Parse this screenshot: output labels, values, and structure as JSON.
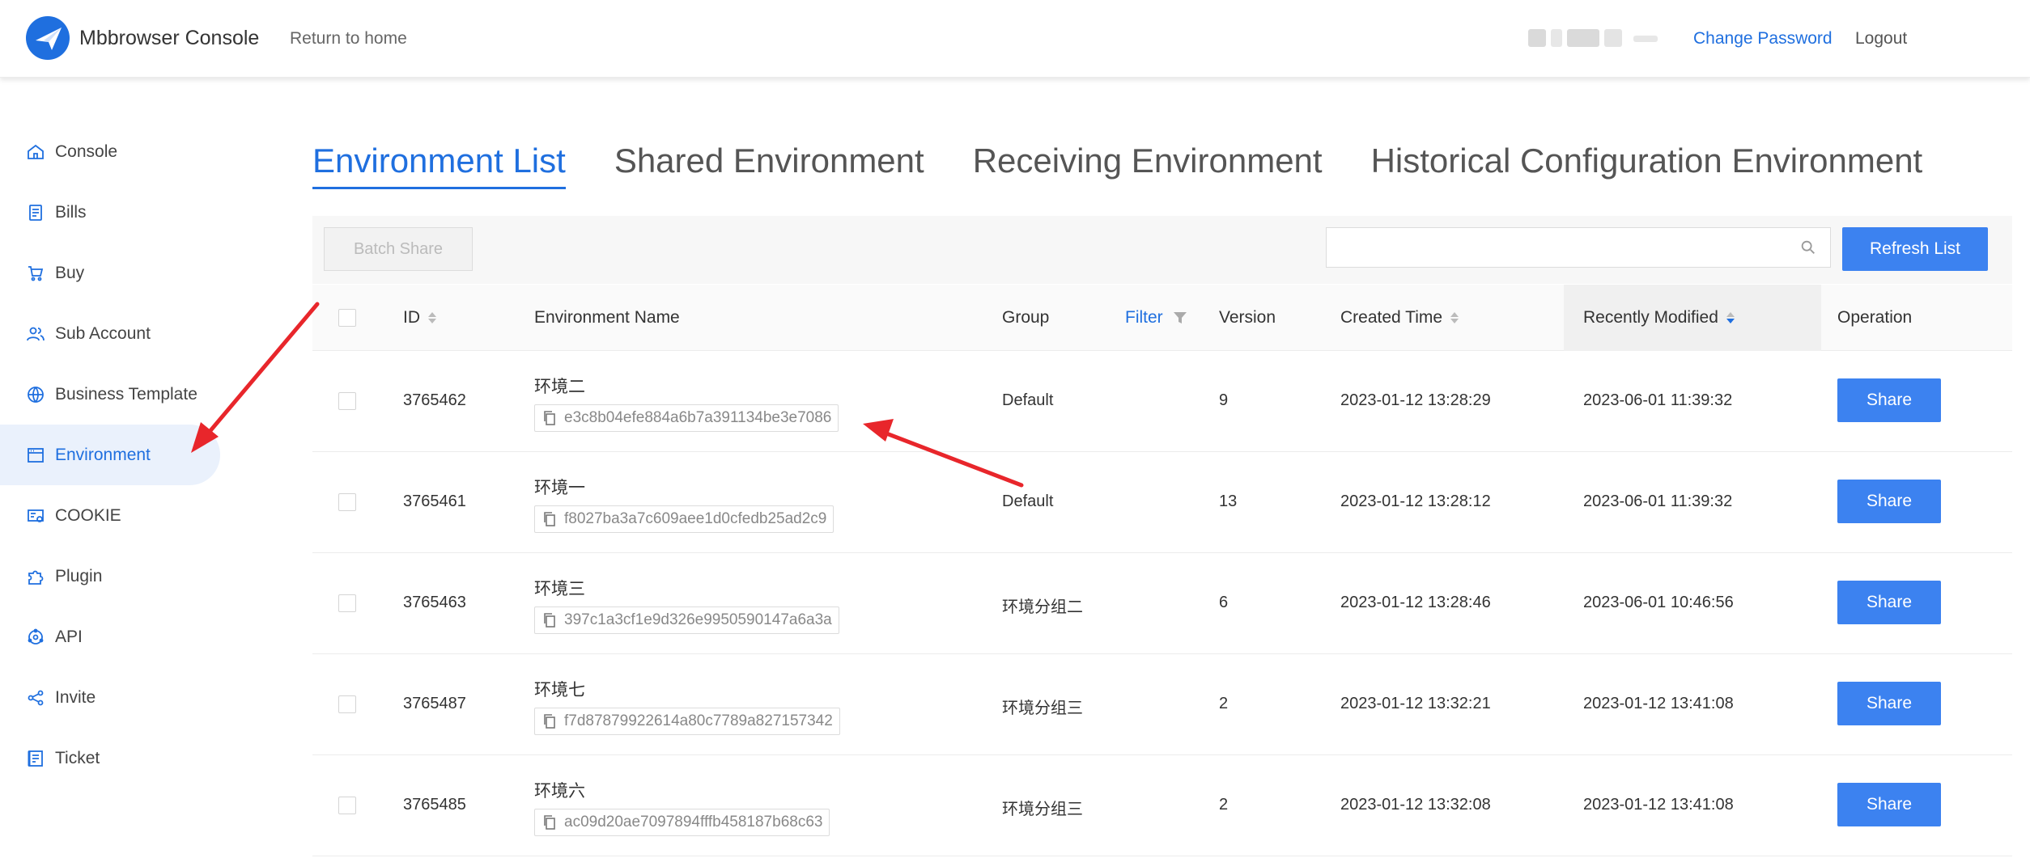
{
  "header": {
    "app_title": "Mbbrowser Console",
    "return_link": "Return to home",
    "change_password": "Change Password",
    "logout": "Logout"
  },
  "sidebar": {
    "items": [
      {
        "label": "Console",
        "icon": "home-icon"
      },
      {
        "label": "Bills",
        "icon": "bill-icon"
      },
      {
        "label": "Buy",
        "icon": "cart-icon"
      },
      {
        "label": "Sub Account",
        "icon": "users-icon"
      },
      {
        "label": "Business Template",
        "icon": "globe-icon"
      },
      {
        "label": "Environment",
        "icon": "window-icon",
        "active": true
      },
      {
        "label": "COOKIE",
        "icon": "cookie-icon"
      },
      {
        "label": "Plugin",
        "icon": "puzzle-icon"
      },
      {
        "label": "API",
        "icon": "api-icon"
      },
      {
        "label": "Invite",
        "icon": "share-icon"
      },
      {
        "label": "Ticket",
        "icon": "ticket-icon"
      }
    ]
  },
  "tabs": [
    {
      "label": "Environment List",
      "active": true
    },
    {
      "label": "Shared Environment"
    },
    {
      "label": "Receiving Environment"
    },
    {
      "label": "Historical Configuration Environment"
    }
  ],
  "toolbar": {
    "batch_share": "Batch Share",
    "search_placeholder": "",
    "refresh": "Refresh List"
  },
  "table": {
    "headers": {
      "id": "ID",
      "name": "Environment Name",
      "group": "Group",
      "filter": "Filter",
      "version": "Version",
      "created": "Created Time",
      "modified": "Recently Modified",
      "operation": "Operation"
    },
    "rows": [
      {
        "id": "3765462",
        "name": "环境二",
        "hash": "e3c8b04efe884a6b7a391134be3e7086",
        "group": "Default",
        "version": "9",
        "created": "2023-01-12 13:28:29",
        "modified": "2023-06-01 11:39:32",
        "action": "Share"
      },
      {
        "id": "3765461",
        "name": "环境一",
        "hash": "f8027ba3a7c609aee1d0cfedb25ad2c9",
        "group": "Default",
        "version": "13",
        "created": "2023-01-12 13:28:12",
        "modified": "2023-06-01 11:39:32",
        "action": "Share"
      },
      {
        "id": "3765463",
        "name": "环境三",
        "hash": "397c1a3cf1e9d326e9950590147a6a3a",
        "group": "环境分组二",
        "version": "6",
        "created": "2023-01-12 13:28:46",
        "modified": "2023-06-01 10:46:56",
        "action": "Share"
      },
      {
        "id": "3765487",
        "name": "环境七",
        "hash": "f7d87879922614a80c7789a827157342",
        "group": "环境分组三",
        "version": "2",
        "created": "2023-01-12 13:32:21",
        "modified": "2023-01-12 13:41:08",
        "action": "Share"
      },
      {
        "id": "3765485",
        "name": "环境六",
        "hash": "ac09d20ae7097894fffb458187b68c63",
        "group": "环境分组三",
        "version": "2",
        "created": "2023-01-12 13:32:08",
        "modified": "2023-01-12 13:41:08",
        "action": "Share"
      }
    ]
  },
  "colors": {
    "accent": "#1f6fdf",
    "button": "#3c82f0",
    "arrow": "#e8262b"
  }
}
